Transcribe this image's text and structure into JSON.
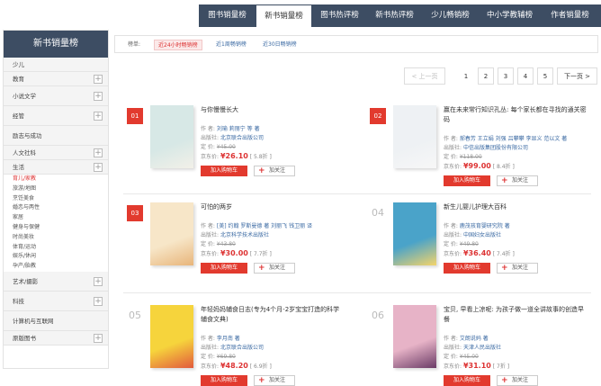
{
  "topnav": {
    "tabs": [
      "图书销量榜",
      "新书销量榜",
      "图书热评榜",
      "新书热评榜",
      "少儿畅销榜",
      "中小学教辅榜",
      "作者销量榜"
    ],
    "active_index": 1
  },
  "sidebar": {
    "title": "新书销量榜",
    "categories": [
      {
        "label": "少儿",
        "expandable": false,
        "tall": false
      },
      {
        "label": "教育",
        "expandable": true,
        "tall": false
      },
      {
        "label": "小说文学",
        "expandable": true,
        "tall": true
      },
      {
        "label": "经管",
        "expandable": true,
        "tall": true
      },
      {
        "label": "励志与成功",
        "expandable": false,
        "tall": true
      },
      {
        "label": "人文社科",
        "expandable": true,
        "tall": false
      },
      {
        "label": "生活",
        "expandable": true,
        "tall": false
      }
    ],
    "sub_items": [
      "育儿/家教",
      "旅游/地图",
      "烹饪美食",
      "婚恋与两性",
      "家居",
      "健身与保健",
      "时尚美妆",
      "体育/运动",
      "娱乐/休闲",
      "孕产/胎教"
    ],
    "sub_active_index": 0,
    "categories_after": [
      {
        "label": "艺术/摄影",
        "expandable": true,
        "tall": true
      },
      {
        "label": "科技",
        "expandable": true,
        "tall": true
      },
      {
        "label": "计算机与互联网",
        "expandable": false,
        "tall": true
      },
      {
        "label": "原版图书",
        "expandable": true,
        "tall": false
      }
    ]
  },
  "filter": {
    "label": "榜单:",
    "options": [
      "近24小时畅销榜",
      "近1周畅销榜",
      "近30日畅销榜"
    ],
    "active_index": 0
  },
  "pager": {
    "prev": "< 上一页",
    "pages": [
      "1",
      "2",
      "3",
      "4",
      "5"
    ],
    "current": "1",
    "next": "下一页 >"
  },
  "products": [
    {
      "rank": "01",
      "highlight": true,
      "title": "与你慢慢长大",
      "author_label": "作    者:",
      "author": "刘瑜 莉丽宁 等 著",
      "publisher_label": "出版社:",
      "publisher": "北京联合出版公司",
      "list_price_label": "定    价:",
      "list_price": "¥45.00",
      "price_label": "京东价:",
      "price": "¥26.10",
      "discount": "[ 5.8折 ]",
      "cover_color": "#d7e8e6",
      "cover_accent": "#f2f0e8"
    },
    {
      "rank": "02",
      "highlight": true,
      "title": "赢在未来常行知识孔丛: 每个家长都在寻找的通关密码",
      "author_label": "作    者:",
      "author": "郝春芳 王立娟 刘强 吕攀攀 李显义 范以文 著",
      "publisher_label": "出版社:",
      "publisher": "中信出版集团股份有限公司",
      "list_price_label": "定    价:",
      "list_price": "¥118.00",
      "price_label": "京东价:",
      "price": "¥99.00",
      "discount": "[ 8.4折 ]",
      "cover_color": "#eef1f4",
      "cover_accent": "#f7f7f7"
    },
    {
      "rank": "03",
      "highlight": true,
      "title": "可怕的两岁",
      "author_label": "作    者:",
      "author": "[美] 约翰 罗斯曼德 著 刘丽飞 钱卫丽 译",
      "publisher_label": "出版社:",
      "publisher": "北京科学技术出版社",
      "list_price_label": "定    价:",
      "list_price": "¥43.80",
      "price_label": "京东价:",
      "price": "¥30.00",
      "discount": "[ 7.7折 ]",
      "cover_color": "#f7e6c8",
      "cover_accent": "#e8b57a"
    },
    {
      "rank": "04",
      "highlight": false,
      "title": "新生儿婴儿护理大百科",
      "author_label": "作    者:",
      "author": "鹿茂孩育婴研究院 著",
      "publisher_label": "出版社:",
      "publisher": "中国妇女出版社",
      "list_price_label": "定    价:",
      "list_price": "¥49.80",
      "price_label": "京东价:",
      "price": "¥36.40",
      "discount": "[ 7.4折 ]",
      "cover_color": "#4aa3c9",
      "cover_accent": "#f4d46a"
    },
    {
      "rank": "05",
      "highlight": false,
      "title": "年轻妈妈辅食日志(专为4个月-2岁宝宝打造的科学辅食文典)",
      "author_label": "作    者:",
      "author": "李月南 著",
      "publisher_label": "出版社:",
      "publisher": "北京联合出版公司",
      "list_price_label": "定    价:",
      "list_price": "¥69.80",
      "price_label": "京东价:",
      "price": "¥48.20",
      "discount": "[ 6.9折 ]",
      "cover_color": "#f6d43c",
      "cover_accent": "#e25a3c"
    },
    {
      "rank": "06",
      "highlight": false,
      "title": "宝贝, 早看上凉呢: 为孩子做一道全讲故事的创造早餐",
      "author_label": "作    者:",
      "author": "艾朗说妈 著",
      "publisher_label": "出版社:",
      "publisher": "天津人民出版社",
      "list_price_label": "定    价:",
      "list_price": "¥45.00",
      "price_label": "京东价:",
      "price": "¥31.10",
      "discount": "[ 7折 ]",
      "cover_color": "#e7b3c7",
      "cover_accent": "#6a3b66"
    }
  ],
  "labels": {
    "add_cart": "加入购物车",
    "add_fav": "加关注"
  },
  "colors": {
    "nav_bg": "#3d4d63",
    "accent_red": "#e23a2e",
    "link_blue": "#3b6aa3"
  }
}
